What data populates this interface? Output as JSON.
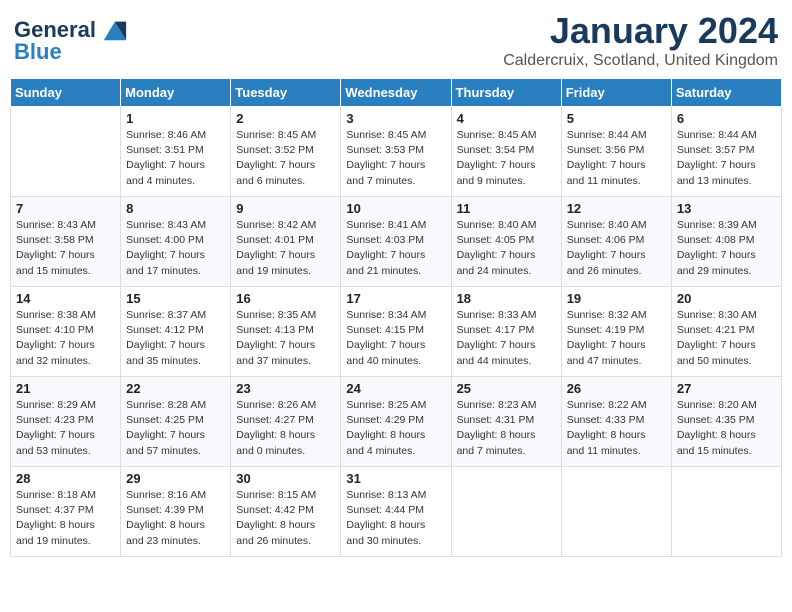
{
  "header": {
    "logo_line1": "General",
    "logo_line2": "Blue",
    "month": "January 2024",
    "location": "Caldercruix, Scotland, United Kingdom"
  },
  "weekdays": [
    "Sunday",
    "Monday",
    "Tuesday",
    "Wednesday",
    "Thursday",
    "Friday",
    "Saturday"
  ],
  "weeks": [
    [
      {
        "day": "",
        "info": ""
      },
      {
        "day": "1",
        "info": "Sunrise: 8:46 AM\nSunset: 3:51 PM\nDaylight: 7 hours\nand 4 minutes."
      },
      {
        "day": "2",
        "info": "Sunrise: 8:45 AM\nSunset: 3:52 PM\nDaylight: 7 hours\nand 6 minutes."
      },
      {
        "day": "3",
        "info": "Sunrise: 8:45 AM\nSunset: 3:53 PM\nDaylight: 7 hours\nand 7 minutes."
      },
      {
        "day": "4",
        "info": "Sunrise: 8:45 AM\nSunset: 3:54 PM\nDaylight: 7 hours\nand 9 minutes."
      },
      {
        "day": "5",
        "info": "Sunrise: 8:44 AM\nSunset: 3:56 PM\nDaylight: 7 hours\nand 11 minutes."
      },
      {
        "day": "6",
        "info": "Sunrise: 8:44 AM\nSunset: 3:57 PM\nDaylight: 7 hours\nand 13 minutes."
      }
    ],
    [
      {
        "day": "7",
        "info": "Sunrise: 8:43 AM\nSunset: 3:58 PM\nDaylight: 7 hours\nand 15 minutes."
      },
      {
        "day": "8",
        "info": "Sunrise: 8:43 AM\nSunset: 4:00 PM\nDaylight: 7 hours\nand 17 minutes."
      },
      {
        "day": "9",
        "info": "Sunrise: 8:42 AM\nSunset: 4:01 PM\nDaylight: 7 hours\nand 19 minutes."
      },
      {
        "day": "10",
        "info": "Sunrise: 8:41 AM\nSunset: 4:03 PM\nDaylight: 7 hours\nand 21 minutes."
      },
      {
        "day": "11",
        "info": "Sunrise: 8:40 AM\nSunset: 4:05 PM\nDaylight: 7 hours\nand 24 minutes."
      },
      {
        "day": "12",
        "info": "Sunrise: 8:40 AM\nSunset: 4:06 PM\nDaylight: 7 hours\nand 26 minutes."
      },
      {
        "day": "13",
        "info": "Sunrise: 8:39 AM\nSunset: 4:08 PM\nDaylight: 7 hours\nand 29 minutes."
      }
    ],
    [
      {
        "day": "14",
        "info": "Sunrise: 8:38 AM\nSunset: 4:10 PM\nDaylight: 7 hours\nand 32 minutes."
      },
      {
        "day": "15",
        "info": "Sunrise: 8:37 AM\nSunset: 4:12 PM\nDaylight: 7 hours\nand 35 minutes."
      },
      {
        "day": "16",
        "info": "Sunrise: 8:35 AM\nSunset: 4:13 PM\nDaylight: 7 hours\nand 37 minutes."
      },
      {
        "day": "17",
        "info": "Sunrise: 8:34 AM\nSunset: 4:15 PM\nDaylight: 7 hours\nand 40 minutes."
      },
      {
        "day": "18",
        "info": "Sunrise: 8:33 AM\nSunset: 4:17 PM\nDaylight: 7 hours\nand 44 minutes."
      },
      {
        "day": "19",
        "info": "Sunrise: 8:32 AM\nSunset: 4:19 PM\nDaylight: 7 hours\nand 47 minutes."
      },
      {
        "day": "20",
        "info": "Sunrise: 8:30 AM\nSunset: 4:21 PM\nDaylight: 7 hours\nand 50 minutes."
      }
    ],
    [
      {
        "day": "21",
        "info": "Sunrise: 8:29 AM\nSunset: 4:23 PM\nDaylight: 7 hours\nand 53 minutes."
      },
      {
        "day": "22",
        "info": "Sunrise: 8:28 AM\nSunset: 4:25 PM\nDaylight: 7 hours\nand 57 minutes."
      },
      {
        "day": "23",
        "info": "Sunrise: 8:26 AM\nSunset: 4:27 PM\nDaylight: 8 hours\nand 0 minutes."
      },
      {
        "day": "24",
        "info": "Sunrise: 8:25 AM\nSunset: 4:29 PM\nDaylight: 8 hours\nand 4 minutes."
      },
      {
        "day": "25",
        "info": "Sunrise: 8:23 AM\nSunset: 4:31 PM\nDaylight: 8 hours\nand 7 minutes."
      },
      {
        "day": "26",
        "info": "Sunrise: 8:22 AM\nSunset: 4:33 PM\nDaylight: 8 hours\nand 11 minutes."
      },
      {
        "day": "27",
        "info": "Sunrise: 8:20 AM\nSunset: 4:35 PM\nDaylight: 8 hours\nand 15 minutes."
      }
    ],
    [
      {
        "day": "28",
        "info": "Sunrise: 8:18 AM\nSunset: 4:37 PM\nDaylight: 8 hours\nand 19 minutes."
      },
      {
        "day": "29",
        "info": "Sunrise: 8:16 AM\nSunset: 4:39 PM\nDaylight: 8 hours\nand 23 minutes."
      },
      {
        "day": "30",
        "info": "Sunrise: 8:15 AM\nSunset: 4:42 PM\nDaylight: 8 hours\nand 26 minutes."
      },
      {
        "day": "31",
        "info": "Sunrise: 8:13 AM\nSunset: 4:44 PM\nDaylight: 8 hours\nand 30 minutes."
      },
      {
        "day": "",
        "info": ""
      },
      {
        "day": "",
        "info": ""
      },
      {
        "day": "",
        "info": ""
      }
    ]
  ]
}
